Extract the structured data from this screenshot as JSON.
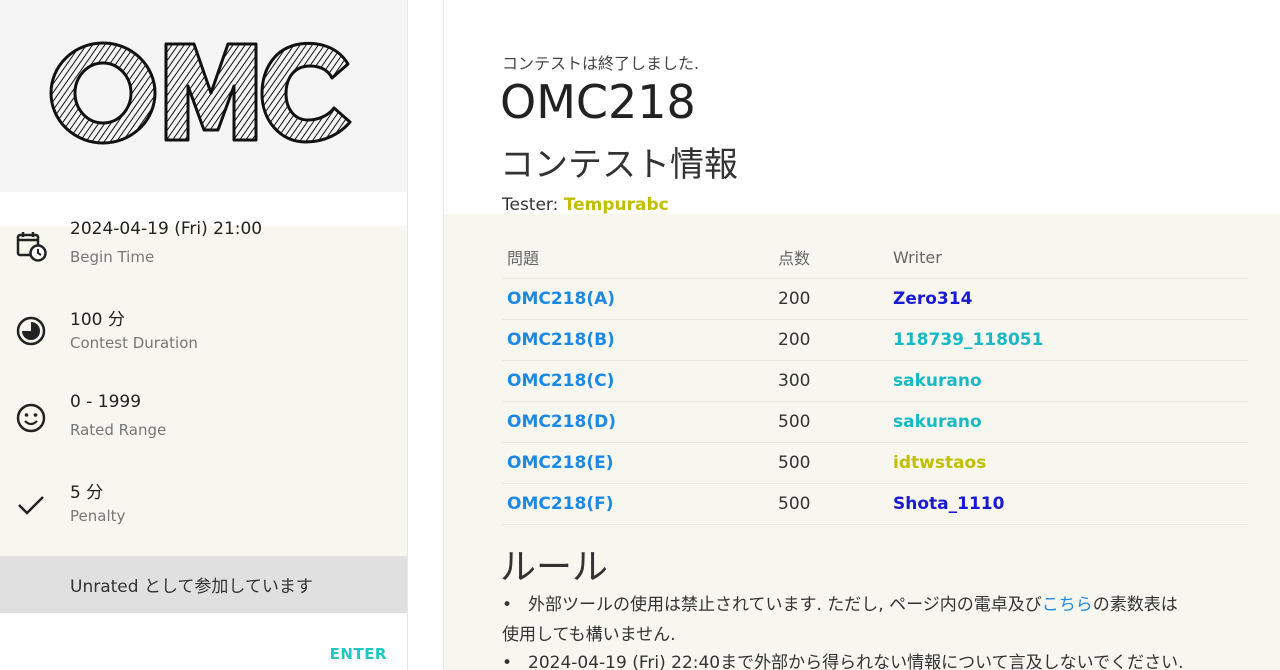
{
  "logo": {
    "text": "OMC"
  },
  "contest": {
    "status": "コンテストは終了しました.",
    "title": "OMC218",
    "info_heading": "コンテスト情報",
    "tester_label": "Tester:",
    "tester_name": "Tempurabc"
  },
  "sidebar": {
    "items": [
      {
        "value": "2024-04-19 (Fri) 21:00",
        "label": "Begin Time",
        "icon": "calendar-clock-icon"
      },
      {
        "value": "100 分",
        "label": "Contest Duration",
        "icon": "pie-timer-icon"
      },
      {
        "value": "0 - 1999",
        "label": "Rated Range",
        "icon": "smiley-icon"
      },
      {
        "value": "5 分",
        "label": "Penalty",
        "icon": "check-icon"
      }
    ],
    "unrated_text": "Unrated として参加しています",
    "enter_label": "ENTER"
  },
  "problems": {
    "headers": [
      "問題",
      "点数",
      "Writer"
    ],
    "rows": [
      {
        "problem": "OMC218(A)",
        "points": "200",
        "writer": "Zero314",
        "writer_color": "#1a1ad6"
      },
      {
        "problem": "OMC218(B)",
        "points": "200",
        "writer": "118739_118051",
        "writer_color": "#19b9c4"
      },
      {
        "problem": "OMC218(C)",
        "points": "300",
        "writer": "sakurano",
        "writer_color": "#19b9c4"
      },
      {
        "problem": "OMC218(D)",
        "points": "500",
        "writer": "sakurano",
        "writer_color": "#19b9c4"
      },
      {
        "problem": "OMC218(E)",
        "points": "500",
        "writer": "idtwstaos",
        "writer_color": "#c0c000"
      },
      {
        "problem": "OMC218(F)",
        "points": "500",
        "writer": "Shota_1110",
        "writer_color": "#1a1ad6"
      }
    ]
  },
  "rules": {
    "heading": "ルール",
    "rule1_before": "外部ツールの使用は禁止されています. ただし, ページ内の電卓及び",
    "rule1_link": "こちら",
    "rule1_after": "の素数表は",
    "rule1_line2": "使用しても構いません.",
    "rule2": "2024-04-19 (Fri) 22:40まで外部から得られない情報について言及しないでください."
  },
  "colors": {
    "link": "#1e88e5",
    "accent": "#1ec7c2",
    "tester": "#c0c000"
  }
}
